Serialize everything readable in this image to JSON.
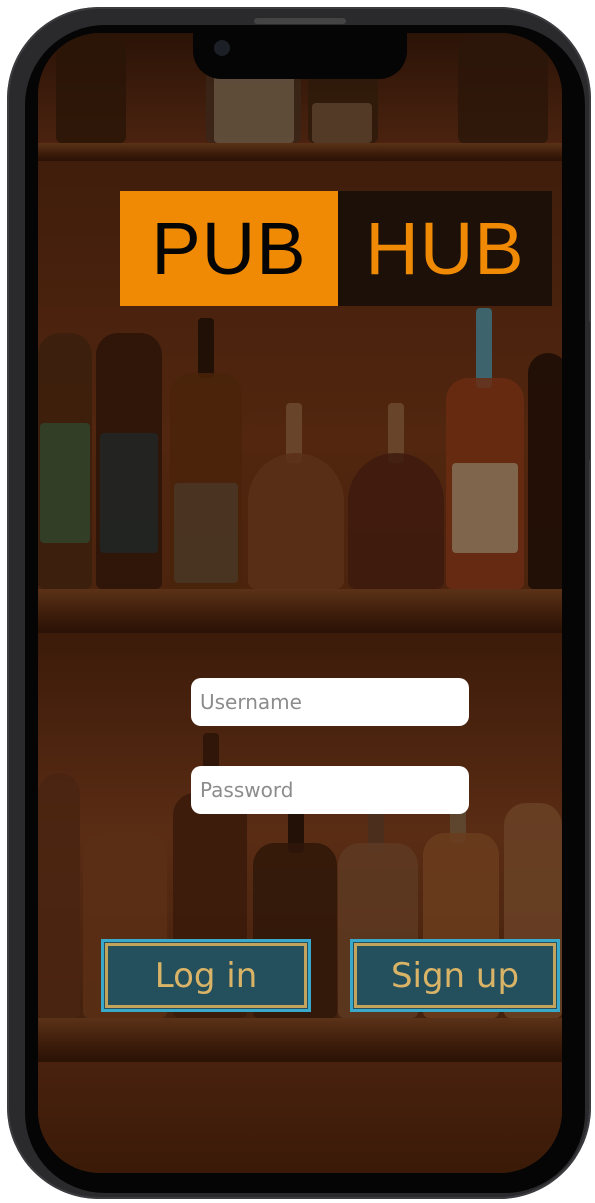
{
  "app": {
    "logo": {
      "left_text": "PUB",
      "right_text": "HUB"
    }
  },
  "login_form": {
    "username": {
      "placeholder": "Username",
      "value": ""
    },
    "password": {
      "placeholder": "Password",
      "value": ""
    },
    "login_label": "Log in",
    "signup_label": "Sign up"
  },
  "colors": {
    "brand_orange": "#f08a04",
    "button_fill": "#24505e",
    "button_text": "#d9b366",
    "button_border": "#3aa9c9"
  }
}
